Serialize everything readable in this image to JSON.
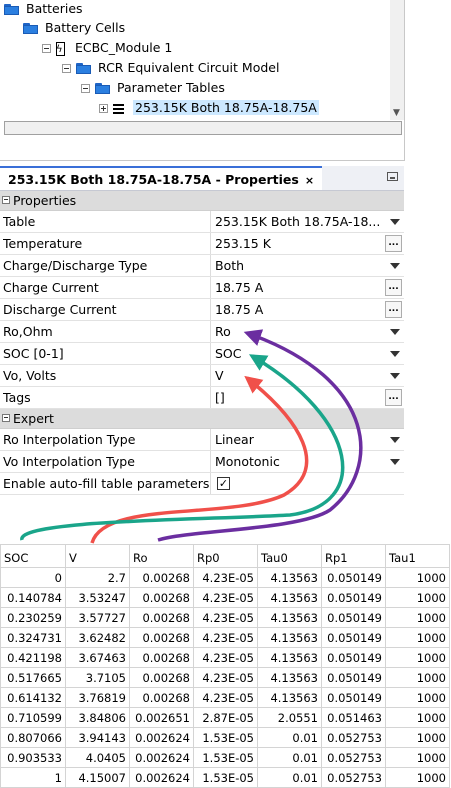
{
  "tree": {
    "nodes": [
      {
        "label": "Batteries",
        "indent": 0
      },
      {
        "label": "Battery Cells",
        "indent": 1
      },
      {
        "label": "ECBC_Module 1",
        "indent": 2
      },
      {
        "label": "RCR Equivalent Circuit Model",
        "indent": 3
      },
      {
        "label": "Parameter Tables",
        "indent": 4
      },
      {
        "label": "253.15K Both 18.75A-18.75A",
        "indent": 5,
        "selected": true
      }
    ]
  },
  "props": {
    "tab_title": "253.15K Both 18.75A-18.75A - Properties",
    "close_glyph": "×",
    "sections": [
      {
        "title": "Properties",
        "rows": [
          {
            "name": "Table",
            "value": "253.15K Both 18.75A-18...",
            "control": "dropdown"
          },
          {
            "name": "Temperature",
            "value": "253.15 K",
            "control": "ellipsis"
          },
          {
            "name": "Charge/Discharge Type",
            "value": "Both",
            "control": "dropdown"
          },
          {
            "name": "Charge Current",
            "value": "18.75 A",
            "control": "ellipsis"
          },
          {
            "name": "Discharge Current",
            "value": "18.75 A",
            "control": "ellipsis"
          },
          {
            "name": "Ro,Ohm",
            "value": "Ro",
            "control": "dropdown"
          },
          {
            "name": "SOC [0-1]",
            "value": "SOC",
            "control": "dropdown"
          },
          {
            "name": "Vo, Volts",
            "value": "V",
            "control": "dropdown"
          },
          {
            "name": "Tags",
            "value": "[]",
            "control": "ellipsis"
          }
        ]
      },
      {
        "title": "Expert",
        "rows": [
          {
            "name": "Ro Interpolation Type",
            "value": "Linear",
            "control": "dropdown"
          },
          {
            "name": "Vo Interpolation Type",
            "value": "Monotonic",
            "control": "dropdown"
          },
          {
            "name": "Enable auto-fill table parameters",
            "value": "✓",
            "control": "checkbox"
          }
        ]
      }
    ],
    "ellipsis_label": "..."
  },
  "colors": {
    "arrow_red": "#f0504a",
    "arrow_green": "#1aa58a",
    "arrow_purple": "#6b2ea0",
    "selection": "#cce8ff"
  },
  "table": {
    "headers": [
      "SOC",
      "V",
      "Ro",
      "Rp0",
      "Tau0",
      "Rp1",
      "Tau1"
    ],
    "rows": [
      [
        "0",
        "2.7",
        "0.00268",
        "4.23E-05",
        "4.13563",
        "0.050149",
        "1000"
      ],
      [
        "0.140784",
        "3.53247",
        "0.00268",
        "4.23E-05",
        "4.13563",
        "0.050149",
        "1000"
      ],
      [
        "0.230259",
        "3.57727",
        "0.00268",
        "4.23E-05",
        "4.13563",
        "0.050149",
        "1000"
      ],
      [
        "0.324731",
        "3.62482",
        "0.00268",
        "4.23E-05",
        "4.13563",
        "0.050149",
        "1000"
      ],
      [
        "0.421198",
        "3.67463",
        "0.00268",
        "4.23E-05",
        "4.13563",
        "0.050149",
        "1000"
      ],
      [
        "0.517665",
        "3.7105",
        "0.00268",
        "4.23E-05",
        "4.13563",
        "0.050149",
        "1000"
      ],
      [
        "0.614132",
        "3.76819",
        "0.00268",
        "4.23E-05",
        "4.13563",
        "0.050149",
        "1000"
      ],
      [
        "0.710599",
        "3.84806",
        "0.002651",
        "2.87E-05",
        "2.0551",
        "0.051463",
        "1000"
      ],
      [
        "0.807066",
        "3.94143",
        "0.002624",
        "1.53E-05",
        "0.01",
        "0.052753",
        "1000"
      ],
      [
        "0.903533",
        "4.0405",
        "0.002624",
        "1.53E-05",
        "0.01",
        "0.052753",
        "1000"
      ],
      [
        "1",
        "4.15007",
        "0.002624",
        "1.53E-05",
        "0.01",
        "0.052753",
        "1000"
      ]
    ]
  }
}
